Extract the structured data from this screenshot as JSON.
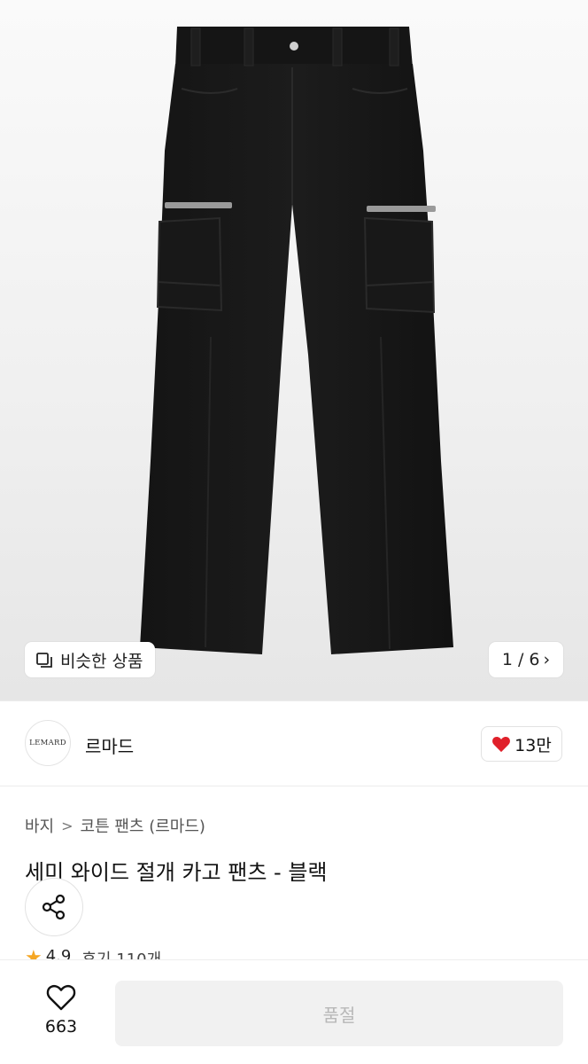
{
  "gallery": {
    "similar_label": "비슷한 상품",
    "pager": "1 / 6"
  },
  "brand": {
    "logo_text": "LEMARD",
    "name": "르마드",
    "like_count": "13만"
  },
  "product": {
    "breadcrumb": [
      "바지",
      "코튼 팬츠 (르마드)"
    ],
    "title": "세미 와이드 절개 카고 팬츠 - 블랙",
    "rating": "4.9",
    "review_label": "후기 110개"
  },
  "bottom_bar": {
    "wishlist_count": "663",
    "soldout_label": "품절"
  },
  "colors": {
    "accent_heart": "#e0202a",
    "star": "#f5a623",
    "disabled_button": "#f1f1f1"
  },
  "icons": [
    "similar-items-icon",
    "chevron-right-icon",
    "heart-filled-icon",
    "share-icon",
    "star-icon",
    "heart-outline-icon"
  ]
}
